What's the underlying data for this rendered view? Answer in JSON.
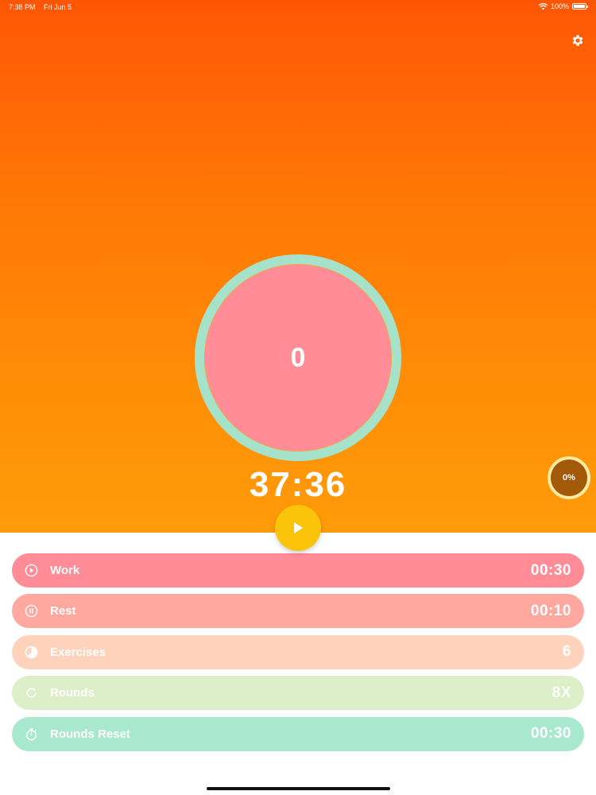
{
  "status_bar": {
    "time": "7:38 PM",
    "date": "Fri Jun 5",
    "battery": "100%"
  },
  "timer": {
    "count": "0",
    "total_time": "37:36",
    "progress_label": "0%"
  },
  "rows": [
    {
      "label": "Work",
      "value": "00:30",
      "icon": "play-circle-icon",
      "color": "#ff8c96"
    },
    {
      "label": "Rest",
      "value": "00:10",
      "icon": "pause-circle-icon",
      "color": "#ffa89f"
    },
    {
      "label": "Exercises",
      "value": "6",
      "icon": "pie-chart-icon",
      "color": "#ffd3bb"
    },
    {
      "label": "Rounds",
      "value": "8X",
      "icon": "refresh-icon",
      "color": "#dcefc8"
    },
    {
      "label": "Rounds Reset",
      "value": "00:30",
      "icon": "stopwatch-icon",
      "color": "#a8e8cf"
    }
  ],
  "colors": {
    "hero_top": "#ff5605",
    "hero_bottom": "#ff9b08",
    "ring": "#a6e2c9",
    "ring_fill": "#ff8c96",
    "play_button": "#fcc30b",
    "progress_badge": "#a35a08"
  }
}
